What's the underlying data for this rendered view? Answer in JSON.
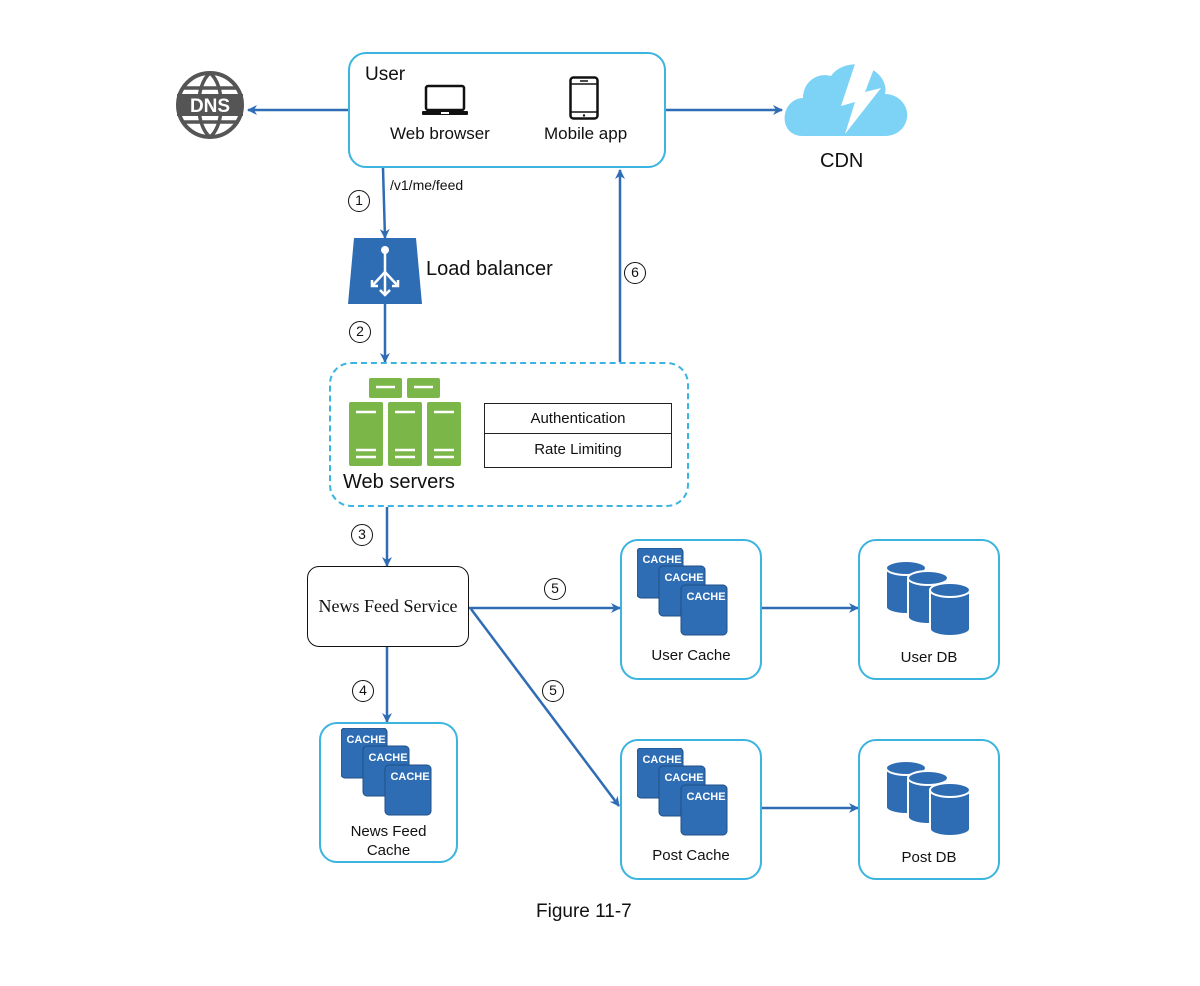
{
  "diagram": {
    "caption": "Figure 11-7",
    "colors": {
      "arrow": "#2e6db4",
      "container_border": "#3bb4e0",
      "cdn_cloud": "#7dd3f5",
      "server_green": "#7ab648",
      "cache_blue": "#2e6db4",
      "db_blue": "#2e6db4",
      "dns_gray": "#555555"
    },
    "nodes": {
      "dns": {
        "label": "DNS",
        "icon": "dns-globe-icon"
      },
      "user": {
        "title": "User",
        "clients": [
          {
            "label": "Web browser",
            "icon": "laptop-icon"
          },
          {
            "label": "Mobile app",
            "icon": "mobile-phone-icon"
          }
        ]
      },
      "cdn": {
        "label": "CDN",
        "icon": "cdn-cloud-icon"
      },
      "load_balancer": {
        "label": "Load balancer",
        "icon": "load-balancer-icon"
      },
      "web_servers": {
        "label": "Web servers",
        "icon": "servers-icon",
        "middleware": [
          "Authentication",
          "Rate Limiting"
        ]
      },
      "news_feed_service": {
        "label": "News Feed Service"
      },
      "news_feed_cache": {
        "label_line1": "News Feed",
        "label_line2": "Cache",
        "icon": "cache-stack-icon",
        "cache_word": "CACHE"
      },
      "user_cache": {
        "label": "User Cache",
        "icon": "cache-stack-icon",
        "cache_word": "CACHE"
      },
      "post_cache": {
        "label": "Post Cache",
        "icon": "cache-stack-icon",
        "cache_word": "CACHE"
      },
      "user_db": {
        "label": "User DB",
        "icon": "database-icon"
      },
      "post_db": {
        "label": "Post DB",
        "icon": "database-icon"
      }
    },
    "edges": [
      {
        "from": "user",
        "to": "dns",
        "step": ""
      },
      {
        "from": "user",
        "to": "cdn",
        "step": ""
      },
      {
        "from": "user",
        "to": "load_balancer",
        "step": "1",
        "label": "/v1/me/feed"
      },
      {
        "from": "load_balancer",
        "to": "web_servers",
        "step": "2"
      },
      {
        "from": "web_servers",
        "to": "news_feed_service",
        "step": "3"
      },
      {
        "from": "news_feed_service",
        "to": "news_feed_cache",
        "step": "4"
      },
      {
        "from": "news_feed_service",
        "to": "user_cache",
        "step": "5"
      },
      {
        "from": "news_feed_service",
        "to": "post_cache",
        "step": "5"
      },
      {
        "from": "web_servers",
        "to": "user",
        "step": "6"
      },
      {
        "from": "user_cache",
        "to": "user_db",
        "step": ""
      },
      {
        "from": "post_cache",
        "to": "post_db",
        "step": ""
      }
    ]
  }
}
